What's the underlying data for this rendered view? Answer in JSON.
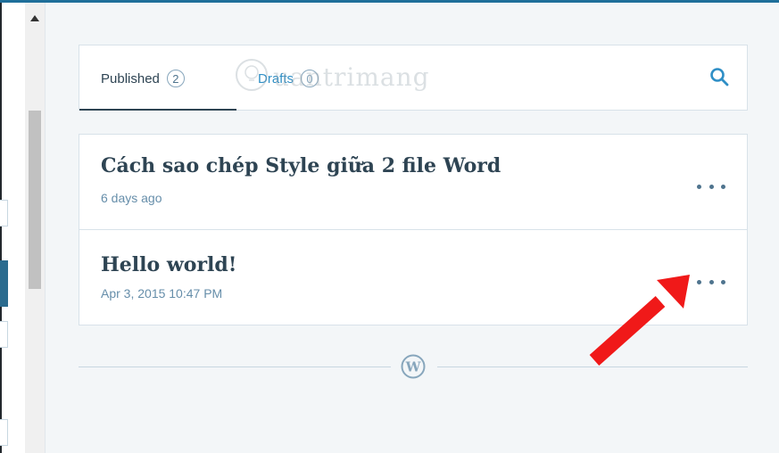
{
  "tabs": {
    "published_label": "Published",
    "published_count": "2",
    "drafts_label": "Drafts",
    "drafts_count": "0",
    "search_icon": "search-icon"
  },
  "watermark": {
    "text": "uantrimang",
    "icon": "bulb-logo-icon"
  },
  "posts": [
    {
      "title": "Cách sao chép Style giữa 2 file Word",
      "date": "6 days ago",
      "menu_icon": "more-icon"
    },
    {
      "title": "Hello world!",
      "date": "Apr 3, 2015 10:47 PM",
      "menu_icon": "more-icon"
    }
  ],
  "footer": {
    "icon": "wordpress-logo-icon"
  },
  "annotation": {
    "icon": "red-arrow-icon",
    "color": "#f01919"
  },
  "colors": {
    "accent": "#2f8fc6",
    "text": "#2e4453",
    "date": "#668eaa",
    "border": "#d8e2e9",
    "background": "#f3f6f8"
  }
}
